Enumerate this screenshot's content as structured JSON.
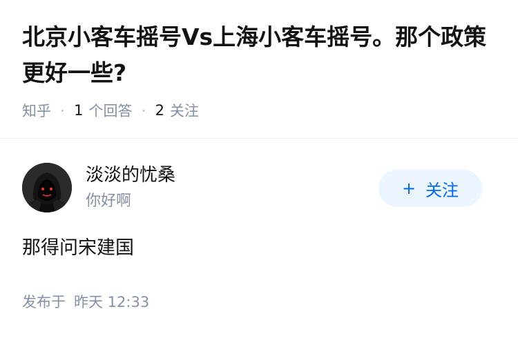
{
  "question": {
    "title": "北京小客车摇号Vs上海小客车摇号。那个政策更好一些?",
    "source": "知乎",
    "answer_count": "1",
    "answer_label": "个回答",
    "follower_count": "2",
    "follower_label": "关注"
  },
  "author": {
    "name": "淡淡的忧桑",
    "bio": "你好啊",
    "avatar_icon": "hooded-figure-avatar"
  },
  "follow_button": {
    "plus": "+",
    "label": "关注"
  },
  "answer": {
    "content": "那得问宋建国",
    "time_label": "发布于",
    "time_value": "昨天 12:33"
  },
  "colors": {
    "accent": "#0066ff",
    "button_bg": "#ebf5ff",
    "muted_text": "#8590a6",
    "primary_text": "#121212"
  }
}
